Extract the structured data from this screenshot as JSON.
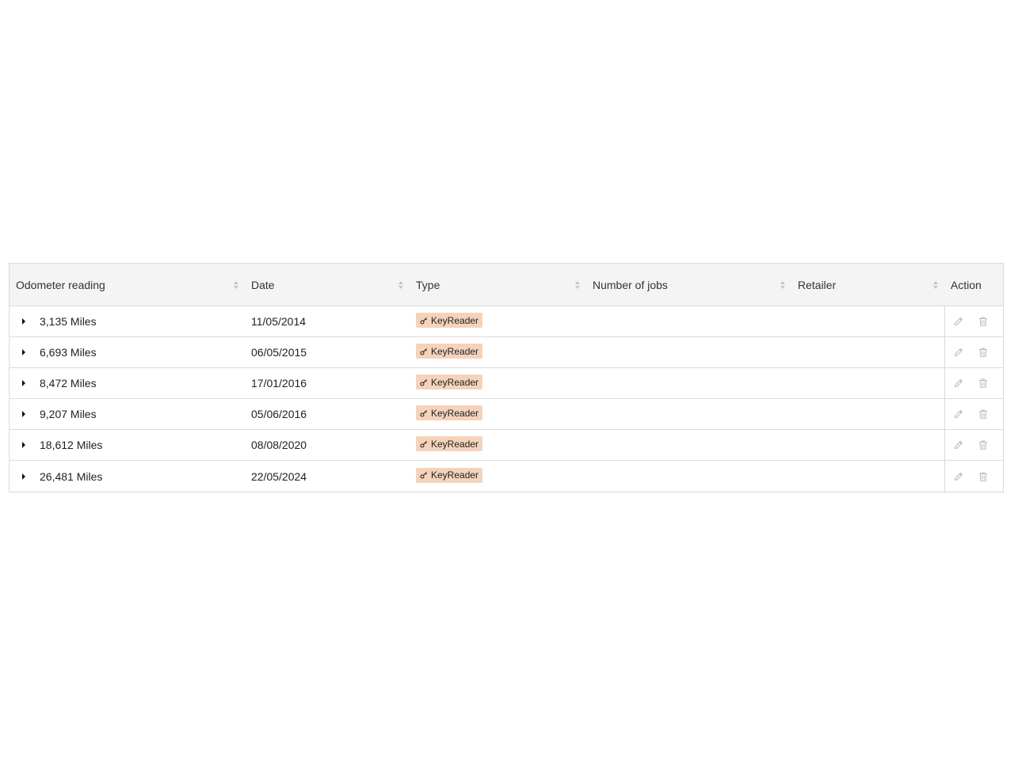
{
  "table": {
    "columns": [
      {
        "label": "Odometer reading",
        "sortable": true
      },
      {
        "label": "Date",
        "sortable": true
      },
      {
        "label": "Type",
        "sortable": true
      },
      {
        "label": "Number of jobs",
        "sortable": true
      },
      {
        "label": "Retailer",
        "sortable": true
      },
      {
        "label": "Action",
        "sortable": false
      }
    ],
    "rows": [
      {
        "odometer": "3,135 Miles",
        "date": "11/05/2014",
        "type": "KeyReader",
        "jobs": "",
        "retailer": ""
      },
      {
        "odometer": "6,693 Miles",
        "date": "06/05/2015",
        "type": "KeyReader",
        "jobs": "",
        "retailer": ""
      },
      {
        "odometer": "8,472 Miles",
        "date": "17/01/2016",
        "type": "KeyReader",
        "jobs": "",
        "retailer": ""
      },
      {
        "odometer": "9,207 Miles",
        "date": "05/06/2016",
        "type": "KeyReader",
        "jobs": "",
        "retailer": ""
      },
      {
        "odometer": "18,612 Miles",
        "date": "08/08/2020",
        "type": "KeyReader",
        "jobs": "",
        "retailer": ""
      },
      {
        "odometer": "26,481 Miles",
        "date": "22/05/2024",
        "type": "KeyReader",
        "jobs": "",
        "retailer": ""
      }
    ]
  },
  "icons": {
    "expand": "caret-right-icon",
    "sort": "sort-icon",
    "type_tag": "key-icon",
    "edit": "pencil-icon",
    "delete": "trash-icon"
  },
  "colors": {
    "header_bg": "#f3f4f3",
    "tag_bg": "#f5d3bb",
    "border": "#d9d9d9",
    "icon_muted": "#b8b8b8"
  }
}
